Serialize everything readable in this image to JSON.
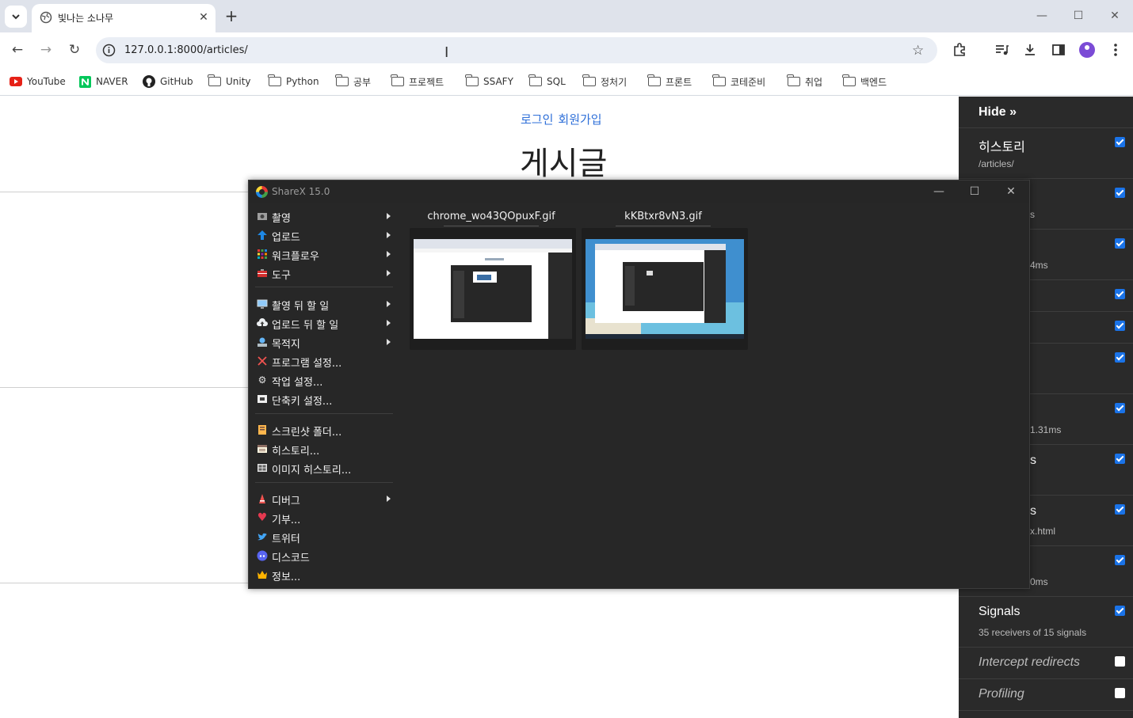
{
  "browser": {
    "tab_title": "빛나는 소나무",
    "url": "127.0.0.1:8000/articles/",
    "bookmarks": [
      "YouTube",
      "NAVER",
      "GitHub",
      "Unity",
      "Python",
      "공부",
      "프로젝트",
      "SSAFY",
      "SQL",
      "정처기",
      "프론트",
      "코테준비",
      "취업",
      "백엔드"
    ]
  },
  "page": {
    "login_link": "로그인",
    "signup_link": "회원가입",
    "heading": "게시글"
  },
  "debug_toolbar": {
    "hide_label": "Hide »",
    "history_title": "히스토리",
    "history_sub": "/articles/",
    "visible_fragments": [
      "s",
      "4ms",
      "1.31ms",
      "s",
      "s",
      "x.html",
      "0ms"
    ],
    "signals_title": "Signals",
    "signals_sub": "35 receivers of 15 signals",
    "intercept_label": "Intercept redirects",
    "profiling_label": "Profiling"
  },
  "sharex": {
    "title": "ShareX 15.0",
    "menu": [
      {
        "label": "촬영",
        "icon": "camera-icon",
        "submenu": true
      },
      {
        "label": "업로드",
        "icon": "upload-arrow-icon",
        "submenu": true
      },
      {
        "label": "워크플로우",
        "icon": "workflow-grid-icon",
        "submenu": true
      },
      {
        "label": "도구",
        "icon": "toolbox-icon",
        "submenu": true
      },
      {
        "label": "촬영 뒤 할 일",
        "icon": "monitor-icon",
        "submenu": true
      },
      {
        "label": "업로드 뒤 할 일",
        "icon": "cloud-upload-icon",
        "submenu": true
      },
      {
        "label": "목적지",
        "icon": "destination-icon",
        "submenu": true
      },
      {
        "label": "프로그램 설정...",
        "icon": "tools-cross-icon",
        "submenu": false
      },
      {
        "label": "작업 설정...",
        "icon": "gear-icon",
        "submenu": false
      },
      {
        "label": "단축키 설정...",
        "icon": "keyboard-icon",
        "submenu": false
      },
      {
        "label": "스크린샷 폴더...",
        "icon": "folder-icon",
        "submenu": false
      },
      {
        "label": "히스토리...",
        "icon": "history-icon",
        "submenu": false
      },
      {
        "label": "이미지 히스토리...",
        "icon": "image-history-icon",
        "submenu": false
      },
      {
        "label": "디버그",
        "icon": "bug-icon",
        "submenu": true
      },
      {
        "label": "기부...",
        "icon": "heart-icon",
        "submenu": false
      },
      {
        "label": "트위터",
        "icon": "twitter-icon",
        "submenu": false
      },
      {
        "label": "디스코드",
        "icon": "discord-icon",
        "submenu": false
      },
      {
        "label": "정보...",
        "icon": "crown-icon",
        "submenu": false
      }
    ],
    "thumbnails": [
      {
        "name": "chrome_wo43QOpuxF.gif"
      },
      {
        "name": "kKBtxr8vN3.gif"
      }
    ]
  },
  "colors": {
    "link_blue": "#2e6fd8",
    "debug_bg": "#2a2a2a",
    "sharex_bg": "#272727",
    "check_blue": "#1a73e8"
  }
}
